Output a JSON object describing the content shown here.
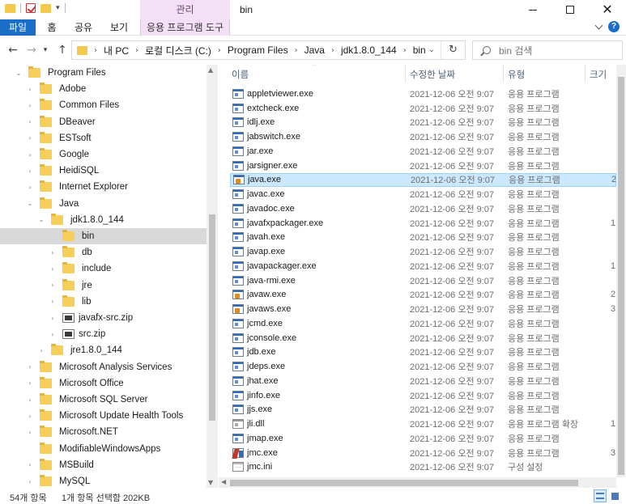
{
  "window": {
    "title": "bin",
    "contextual_tab_group": "관리"
  },
  "ribbon": {
    "tabs": [
      "파일",
      "홈",
      "공유",
      "보기",
      "응용 프로그램 도구"
    ]
  },
  "address": {
    "crumbs": [
      "내 PC",
      "로컬 디스크 (C:)",
      "Program Files",
      "Java",
      "jdk1.8.0_144",
      "bin"
    ],
    "search_placeholder": "bin 검색"
  },
  "tree": [
    {
      "label": "Program Files",
      "level": 0,
      "expanded": true,
      "icon": "folder-icon"
    },
    {
      "label": "Adobe",
      "level": 1,
      "expanded": false,
      "icon": "folder-icon"
    },
    {
      "label": "Common Files",
      "level": 1,
      "expanded": false,
      "icon": "folder-icon"
    },
    {
      "label": "DBeaver",
      "level": 1,
      "expanded": false,
      "icon": "folder-icon"
    },
    {
      "label": "ESTsoft",
      "level": 1,
      "expanded": false,
      "icon": "folder-icon"
    },
    {
      "label": "Google",
      "level": 1,
      "expanded": false,
      "icon": "folder-icon"
    },
    {
      "label": "HeidiSQL",
      "level": 1,
      "expanded": false,
      "icon": "folder-icon"
    },
    {
      "label": "Internet Explorer",
      "level": 1,
      "expanded": false,
      "icon": "folder-icon"
    },
    {
      "label": "Java",
      "level": 1,
      "expanded": true,
      "icon": "folder-icon"
    },
    {
      "label": "jdk1.8.0_144",
      "level": 2,
      "expanded": true,
      "icon": "folder-icon"
    },
    {
      "label": "bin",
      "level": 3,
      "expanded": null,
      "icon": "folder-icon",
      "selected": true
    },
    {
      "label": "db",
      "level": 3,
      "expanded": false,
      "icon": "folder-icon"
    },
    {
      "label": "include",
      "level": 3,
      "expanded": false,
      "icon": "folder-icon"
    },
    {
      "label": "jre",
      "level": 3,
      "expanded": false,
      "icon": "folder-icon"
    },
    {
      "label": "lib",
      "level": 3,
      "expanded": false,
      "icon": "folder-icon"
    },
    {
      "label": "javafx-src.zip",
      "level": 3,
      "expanded": false,
      "icon": "zip-icon"
    },
    {
      "label": "src.zip",
      "level": 3,
      "expanded": false,
      "icon": "zip-icon"
    },
    {
      "label": "jre1.8.0_144",
      "level": 2,
      "expanded": false,
      "icon": "folder-icon"
    },
    {
      "label": "Microsoft Analysis Services",
      "level": 1,
      "expanded": false,
      "icon": "folder-icon"
    },
    {
      "label": "Microsoft Office",
      "level": 1,
      "expanded": false,
      "icon": "folder-icon"
    },
    {
      "label": "Microsoft SQL Server",
      "level": 1,
      "expanded": false,
      "icon": "folder-icon"
    },
    {
      "label": "Microsoft Update Health Tools",
      "level": 1,
      "expanded": false,
      "icon": "folder-icon"
    },
    {
      "label": "Microsoft.NET",
      "level": 1,
      "expanded": false,
      "icon": "folder-icon"
    },
    {
      "label": "ModifiableWindowsApps",
      "level": 1,
      "expanded": null,
      "icon": "folder-icon"
    },
    {
      "label": "MSBuild",
      "level": 1,
      "expanded": false,
      "icon": "folder-icon"
    },
    {
      "label": "MySQL",
      "level": 1,
      "expanded": false,
      "icon": "folder-icon"
    }
  ],
  "list": {
    "columns": {
      "name": "이름",
      "date": "수정한 날짜",
      "type": "유형",
      "size": "크기"
    },
    "rows": [
      {
        "name": "appletviewer.exe",
        "date": "2021-12-06 오전 9:07",
        "type": "응용 프로그램",
        "size": "",
        "icon": "exe"
      },
      {
        "name": "extcheck.exe",
        "date": "2021-12-06 오전 9:07",
        "type": "응용 프로그램",
        "size": "",
        "icon": "exe"
      },
      {
        "name": "idlj.exe",
        "date": "2021-12-06 오전 9:07",
        "type": "응용 프로그램",
        "size": "",
        "icon": "exe"
      },
      {
        "name": "jabswitch.exe",
        "date": "2021-12-06 오전 9:07",
        "type": "응용 프로그램",
        "size": "",
        "icon": "exe"
      },
      {
        "name": "jar.exe",
        "date": "2021-12-06 오전 9:07",
        "type": "응용 프로그램",
        "size": "",
        "icon": "exe"
      },
      {
        "name": "jarsigner.exe",
        "date": "2021-12-06 오전 9:07",
        "type": "응용 프로그램",
        "size": "",
        "icon": "exe"
      },
      {
        "name": "java.exe",
        "date": "2021-12-06 오전 9:07",
        "type": "응용 프로그램",
        "size": "2",
        "icon": "java",
        "selected": true
      },
      {
        "name": "javac.exe",
        "date": "2021-12-06 오전 9:07",
        "type": "응용 프로그램",
        "size": "",
        "icon": "exe"
      },
      {
        "name": "javadoc.exe",
        "date": "2021-12-06 오전 9:07",
        "type": "응용 프로그램",
        "size": "",
        "icon": "exe"
      },
      {
        "name": "javafxpackager.exe",
        "date": "2021-12-06 오전 9:07",
        "type": "응용 프로그램",
        "size": "1",
        "icon": "exe"
      },
      {
        "name": "javah.exe",
        "date": "2021-12-06 오전 9:07",
        "type": "응용 프로그램",
        "size": "",
        "icon": "exe"
      },
      {
        "name": "javap.exe",
        "date": "2021-12-06 오전 9:07",
        "type": "응용 프로그램",
        "size": "",
        "icon": "exe"
      },
      {
        "name": "javapackager.exe",
        "date": "2021-12-06 오전 9:07",
        "type": "응용 프로그램",
        "size": "1",
        "icon": "exe"
      },
      {
        "name": "java-rmi.exe",
        "date": "2021-12-06 오전 9:07",
        "type": "응용 프로그램",
        "size": "",
        "icon": "exe"
      },
      {
        "name": "javaw.exe",
        "date": "2021-12-06 오전 9:07",
        "type": "응용 프로그램",
        "size": "2",
        "icon": "java"
      },
      {
        "name": "javaws.exe",
        "date": "2021-12-06 오전 9:07",
        "type": "응용 프로그램",
        "size": "3",
        "icon": "java"
      },
      {
        "name": "jcmd.exe",
        "date": "2021-12-06 오전 9:07",
        "type": "응용 프로그램",
        "size": "",
        "icon": "exe"
      },
      {
        "name": "jconsole.exe",
        "date": "2021-12-06 오전 9:07",
        "type": "응용 프로그램",
        "size": "",
        "icon": "exe"
      },
      {
        "name": "jdb.exe",
        "date": "2021-12-06 오전 9:07",
        "type": "응용 프로그램",
        "size": "",
        "icon": "exe"
      },
      {
        "name": "jdeps.exe",
        "date": "2021-12-06 오전 9:07",
        "type": "응용 프로그램",
        "size": "",
        "icon": "exe"
      },
      {
        "name": "jhat.exe",
        "date": "2021-12-06 오전 9:07",
        "type": "응용 프로그램",
        "size": "",
        "icon": "exe"
      },
      {
        "name": "jinfo.exe",
        "date": "2021-12-06 오전 9:07",
        "type": "응용 프로그램",
        "size": "",
        "icon": "exe"
      },
      {
        "name": "jjs.exe",
        "date": "2021-12-06 오전 9:07",
        "type": "응용 프로그램",
        "size": "",
        "icon": "exe"
      },
      {
        "name": "jli.dll",
        "date": "2021-12-06 오전 9:07",
        "type": "응용 프로그램 확장",
        "size": "1",
        "icon": "dll"
      },
      {
        "name": "jmap.exe",
        "date": "2021-12-06 오전 9:07",
        "type": "응용 프로그램",
        "size": "",
        "icon": "exe"
      },
      {
        "name": "jmc.exe",
        "date": "2021-12-06 오전 9:07",
        "type": "응용 프로그램",
        "size": "3",
        "icon": "jmc"
      },
      {
        "name": "jmc.ini",
        "date": "2021-12-06 오전 9:07",
        "type": "구성 설정",
        "size": "",
        "icon": "ini"
      }
    ]
  },
  "status": {
    "item_count": "54개 항목",
    "selection": "1개 항목 선택함 202KB"
  },
  "colors": {
    "accent": "#1a6ec7",
    "contextual_tab": "#f3e0f6",
    "selection": "#cce8ff",
    "tree_selection": "#d9d9d9"
  }
}
